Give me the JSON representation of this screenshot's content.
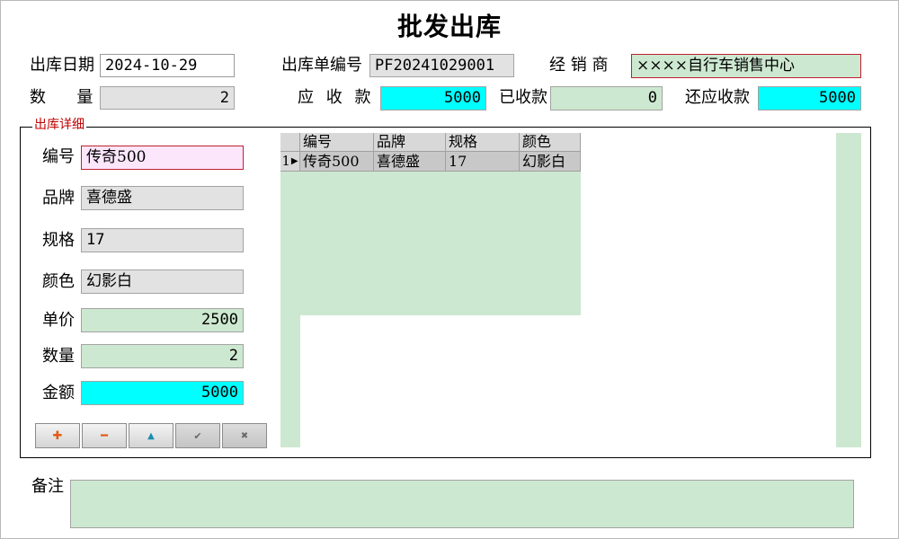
{
  "title": "批发出库",
  "header": {
    "out_date_label": "出库日期",
    "out_date_value": "2024-10-29",
    "order_no_label": "出库单编号",
    "order_no_value": "PF20241029001",
    "dealer_label": "经 销 商",
    "dealer_value": "××××自行车销售中心",
    "qty_label": "数      量",
    "qty_value": "2",
    "receivable_label": "应 收 款",
    "receivable_value": "5000",
    "received_label": "已收款",
    "received_value": "0",
    "remaining_label": "还应收款",
    "remaining_value": "5000"
  },
  "detail": {
    "group_label": "出库详细",
    "code_label": "编号",
    "code_value": "传奇500",
    "brand_label": "品牌",
    "brand_value": "喜德盛",
    "spec_label": "规格",
    "spec_value": "17",
    "color_label": "颜色",
    "color_value": "幻影白",
    "price_label": "单价",
    "price_value": "2500",
    "quantity_label": "数量",
    "quantity_value": "2",
    "amount_label": "金额",
    "amount_value": "5000"
  },
  "buttons": {
    "add": "✚",
    "delete": "━",
    "up": "▲",
    "confirm": "✔",
    "cancel": "✖"
  },
  "grid": {
    "columns": [
      "编号",
      "品牌",
      "规格",
      "颜色"
    ],
    "rows": [
      {
        "indicator": "1",
        "cells": [
          "传奇500",
          "喜德盛",
          "17",
          "幻影白"
        ]
      }
    ]
  },
  "remark": {
    "label": "备注",
    "value": ""
  },
  "colors": {
    "cyan_field": "#00ffff",
    "green_field": "#cde8d0",
    "pink_field": "#fbe6fb",
    "gray_field": "#e2e2e2",
    "required_border": "#c0202f",
    "group_label": "#c00000"
  }
}
